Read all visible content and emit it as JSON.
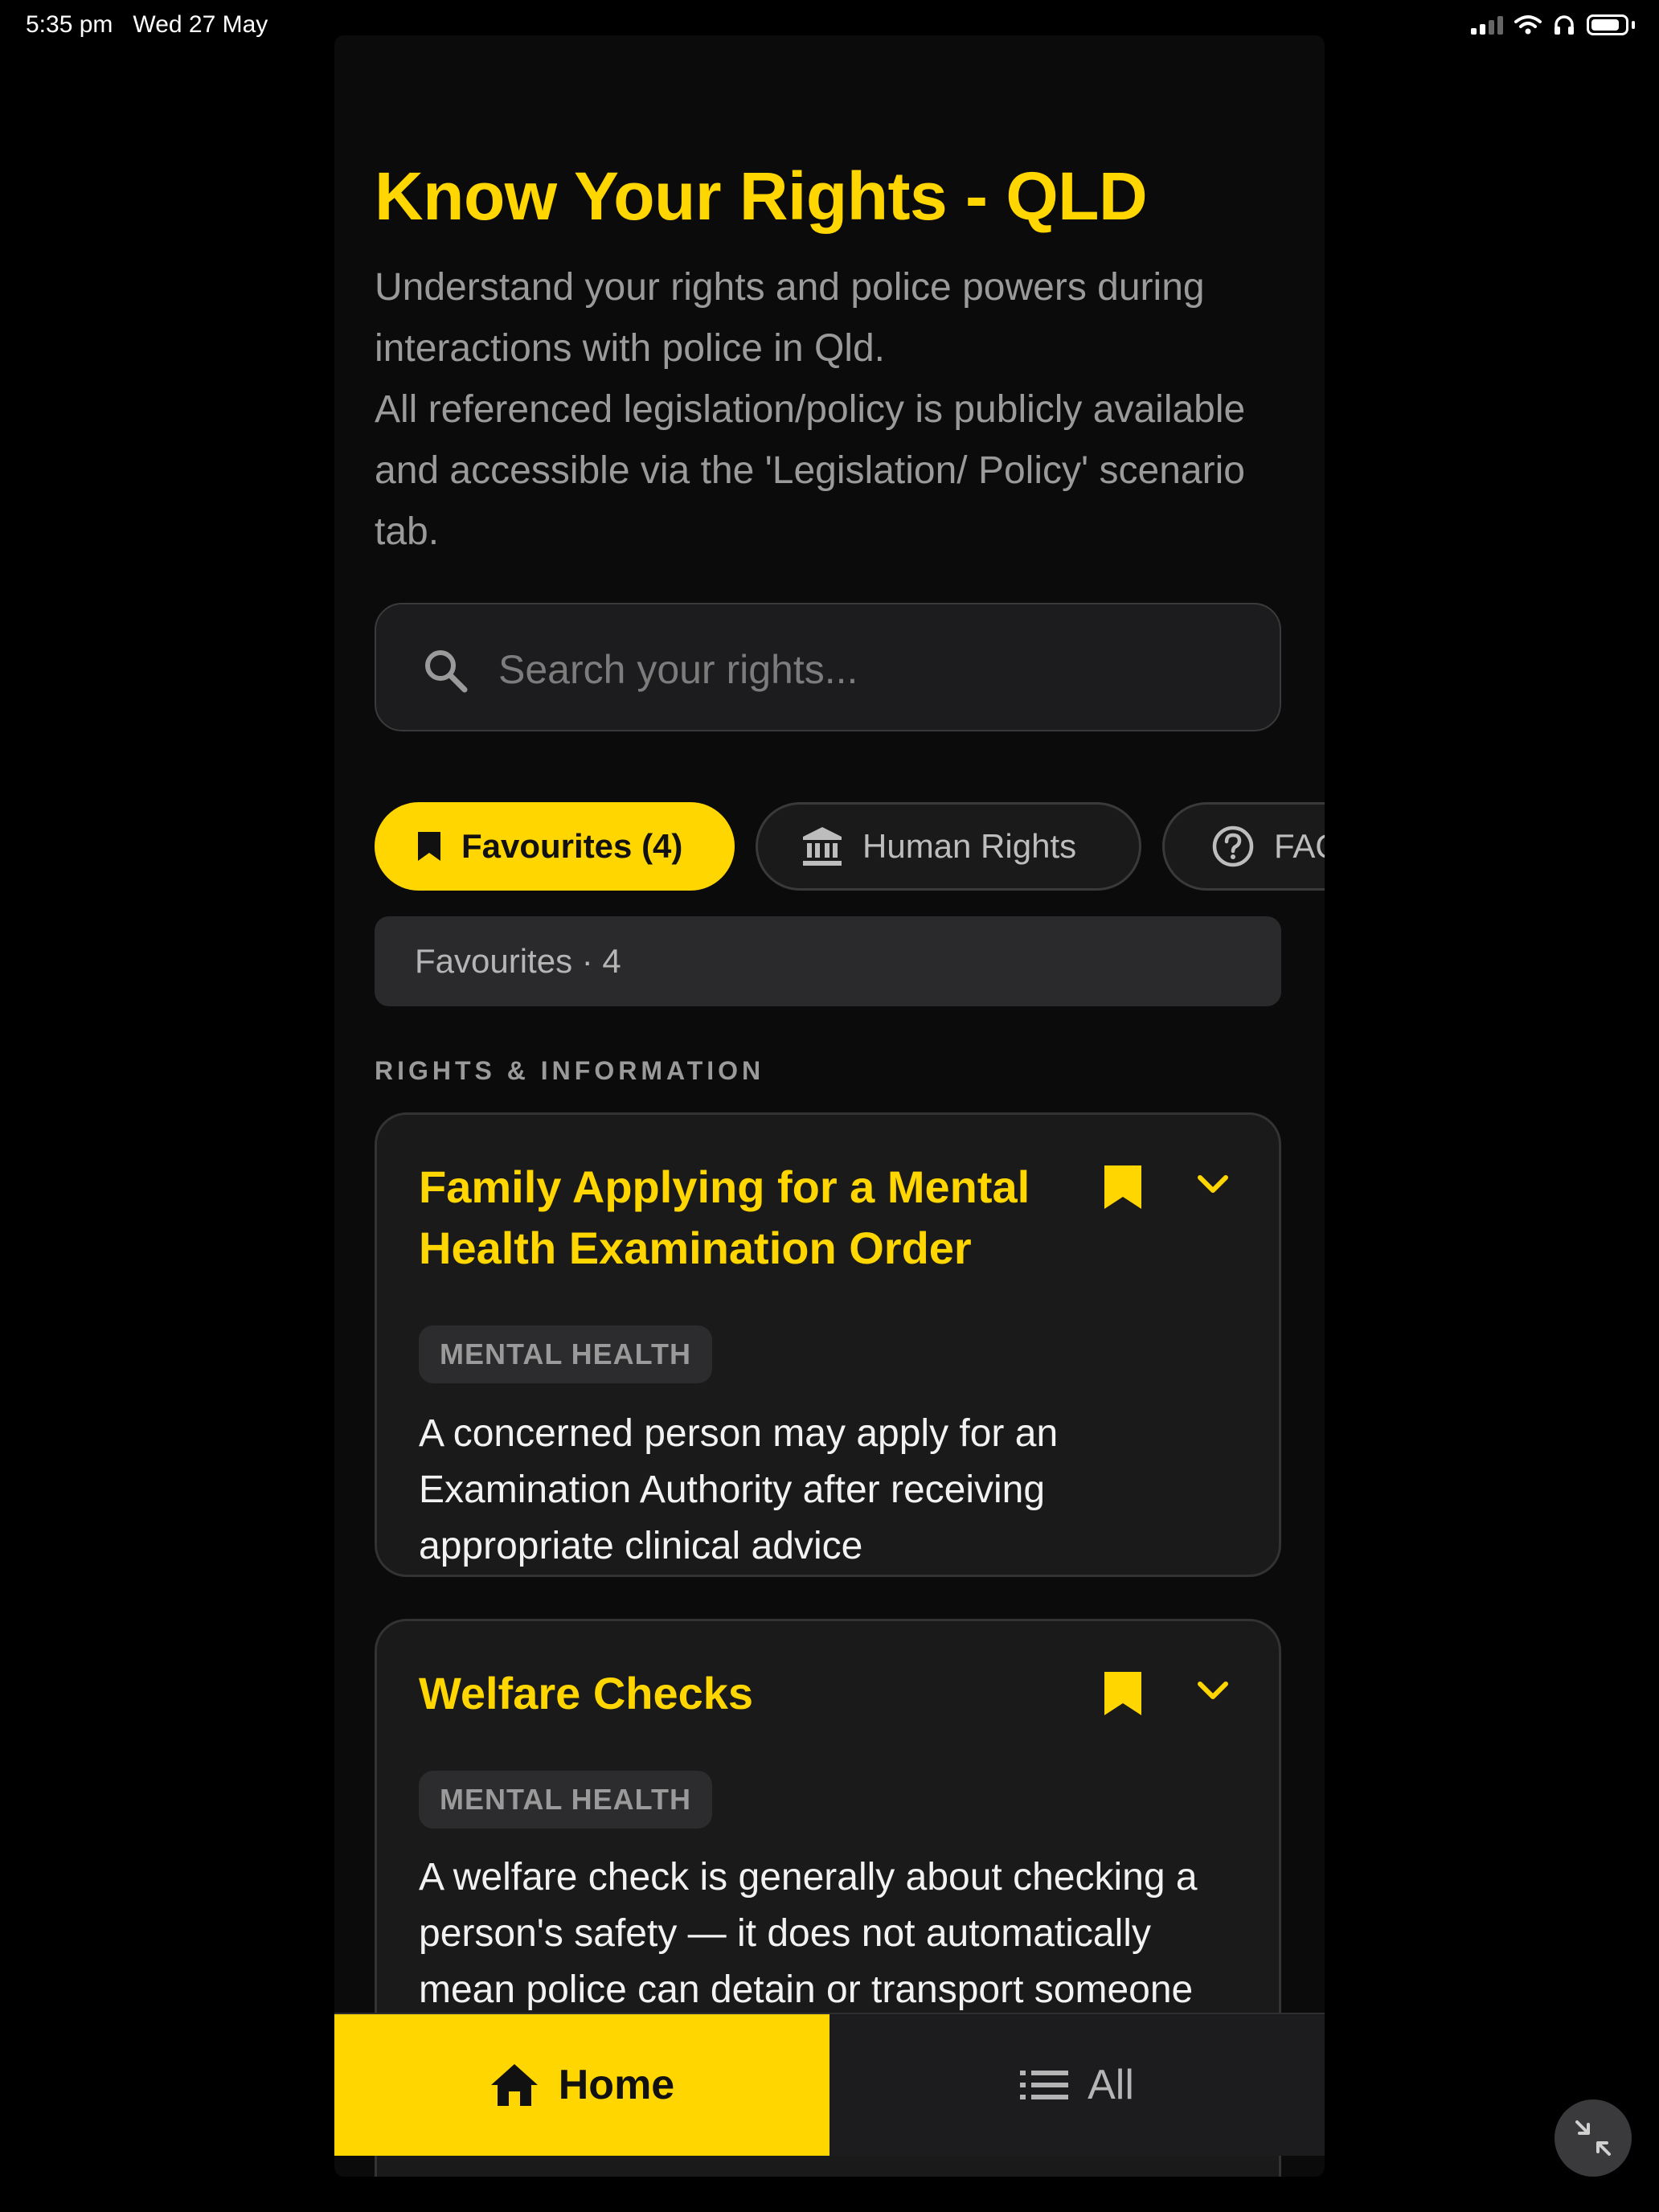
{
  "status_bar": {
    "time": "5:35 pm",
    "date": "Wed 27 May",
    "icons": [
      "cellular-signal-icon",
      "wifi-icon",
      "headphones-icon",
      "battery-icon"
    ]
  },
  "header": {
    "title": "Know Your Rights - QLD",
    "intro_line_1": "Understand your rights and police powers during interactions with police in Qld.",
    "intro_line_2": "All referenced legislation/policy is publicly available and accessible via the 'Legislation/ Policy' scenario tab."
  },
  "search": {
    "placeholder": "Search your rights...",
    "value": ""
  },
  "chips": [
    {
      "label": "Favourites (4)",
      "icon": "bookmark-icon",
      "active": true
    },
    {
      "label": "Human Rights",
      "icon": "bank-icon",
      "active": false
    },
    {
      "label": "FAQ",
      "icon": "help-circle-icon",
      "active": false
    }
  ],
  "favourites_bar": {
    "label": "Favourites · 4"
  },
  "section": {
    "label": "RIGHTS & INFORMATION"
  },
  "cards": [
    {
      "title": "Family Applying for a Mental Health Examination Order",
      "tag": "MENTAL HEALTH",
      "description": "A concerned person may apply for an Examination Authority after receiving appropriate clinical advice",
      "bookmarked": true
    },
    {
      "title": "Welfare Checks",
      "tag": "MENTAL HEALTH",
      "description": "A welfare check is generally about checking a person's safety — it does not automatically mean police can detain or transport someone",
      "bookmarked": true
    }
  ],
  "bottom_nav": {
    "home_label": "Home",
    "all_label": "All"
  },
  "colors": {
    "accent": "#ffd600",
    "background": "#0b0b0b",
    "card": "#1a1a1a",
    "muted_text": "#9a9a9a"
  }
}
